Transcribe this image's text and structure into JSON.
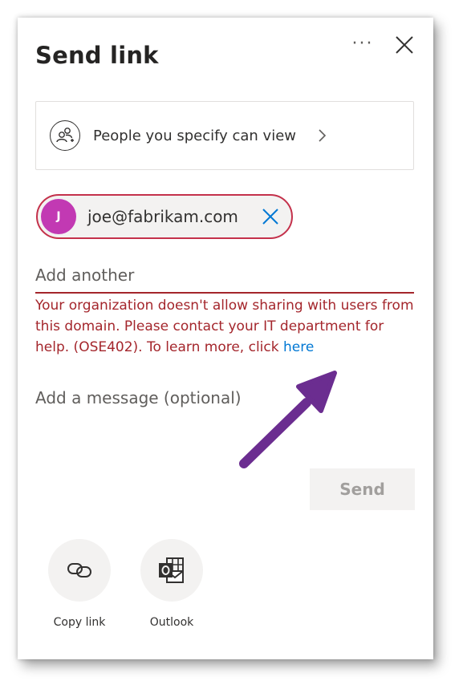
{
  "dialog": {
    "title": "Send link",
    "more_label": "···"
  },
  "permissions": {
    "label": "People you specify can view"
  },
  "recipient": {
    "initial": "J",
    "email": "joe@fabrikam.com"
  },
  "add_another": {
    "placeholder": "Add another"
  },
  "error": {
    "text": "Your organization doesn't allow sharing with users from this domain. Please contact your IT department for help. (OSE402). To learn more, click ",
    "link": "here"
  },
  "message": {
    "placeholder": "Add a message (optional)"
  },
  "send": {
    "label": "Send"
  },
  "share_options": [
    {
      "label": "Copy link",
      "icon": "link-icon"
    },
    {
      "label": "Outlook",
      "icon": "outlook-icon"
    }
  ],
  "colors": {
    "error": "#a4262c",
    "link": "#0078d4",
    "avatar": "#c239b3",
    "arrow": "#6b2d90"
  }
}
